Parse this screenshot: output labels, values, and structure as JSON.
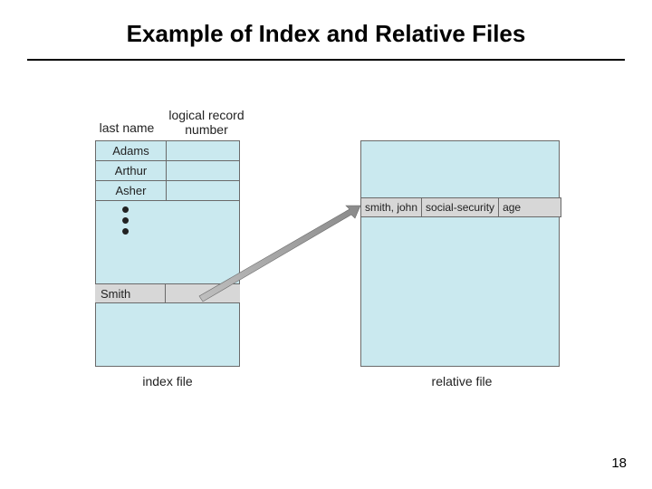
{
  "title": "Example of Index and Relative Files",
  "headers": {
    "last_name": "last name",
    "logical_record_number_l1": "logical record",
    "logical_record_number_l2": "number"
  },
  "index_rows": {
    "r0": "Adams",
    "r1": "Arthur",
    "r2": "Asher",
    "smith": "Smith"
  },
  "record": {
    "f0": "smith, john",
    "f1": "social-security",
    "f2": "age"
  },
  "captions": {
    "index": "index file",
    "relative": "relative file"
  },
  "page_number": "18"
}
